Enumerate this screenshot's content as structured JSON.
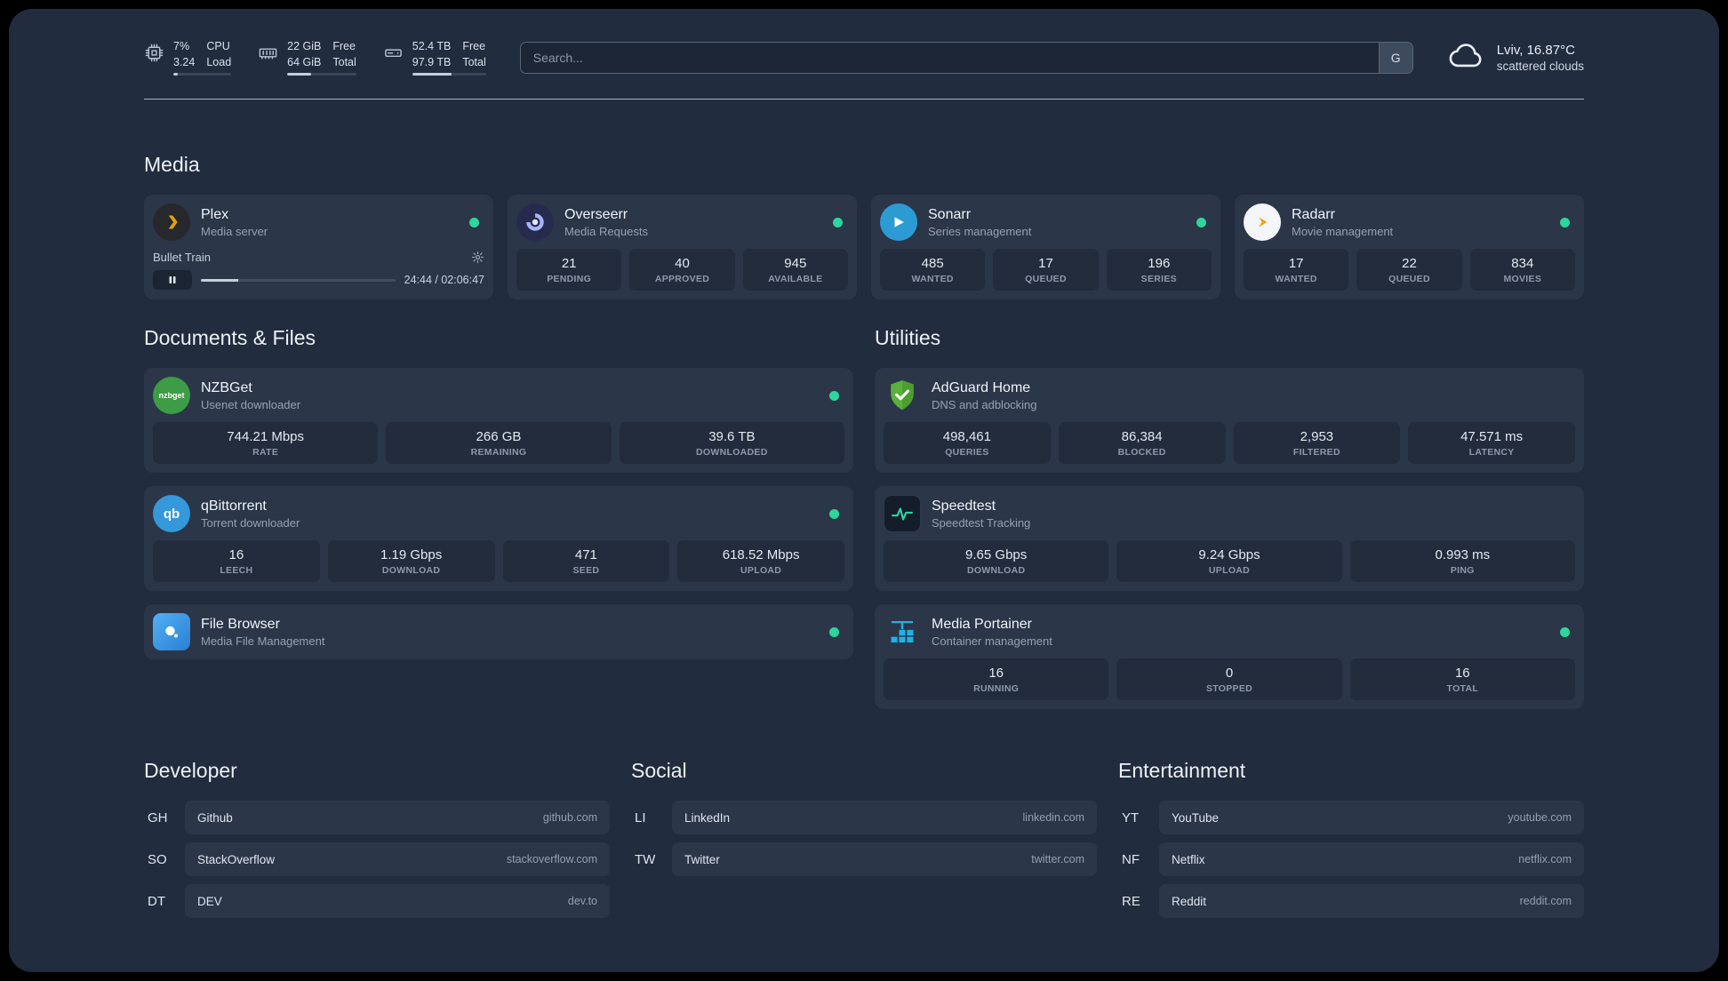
{
  "topbar": {
    "cpu": {
      "value_top": "7%",
      "value_bottom": "3.24",
      "label_top": "CPU",
      "label_bottom": "Load",
      "bar_percent": 7
    },
    "memory": {
      "value_top": "22 GiB",
      "value_bottom": "64 GiB",
      "label_top": "Free",
      "label_bottom": "Total",
      "bar_percent": 34
    },
    "disk": {
      "value_top": "52.4 TB",
      "value_bottom": "97.9 TB",
      "label_top": "Free",
      "label_bottom": "Total",
      "bar_percent": 53
    },
    "search": {
      "placeholder": "Search...",
      "button_label": "G"
    },
    "weather": {
      "location": "Lviv, 16.87°C",
      "condition": "scattered clouds"
    }
  },
  "sections": {
    "media": "Media",
    "documents": "Documents & Files",
    "utilities": "Utilities",
    "developer": "Developer",
    "social": "Social",
    "entertainment": "Entertainment"
  },
  "apps": {
    "plex": {
      "name": "Plex",
      "subtitle": "Media server",
      "status": "online",
      "player": {
        "track": "Bullet Train",
        "time": "24:44 / 02:06:47",
        "progress_percent": 19
      }
    },
    "overseerr": {
      "name": "Overseerr",
      "subtitle": "Media Requests",
      "status": "online",
      "stats": [
        {
          "value": "21",
          "label": "PENDING"
        },
        {
          "value": "40",
          "label": "APPROVED"
        },
        {
          "value": "945",
          "label": "AVAILABLE"
        }
      ]
    },
    "sonarr": {
      "name": "Sonarr",
      "subtitle": "Series management",
      "status": "online",
      "stats": [
        {
          "value": "485",
          "label": "WANTED"
        },
        {
          "value": "17",
          "label": "QUEUED"
        },
        {
          "value": "196",
          "label": "SERIES"
        }
      ]
    },
    "radarr": {
      "name": "Radarr",
      "subtitle": "Movie management",
      "status": "online",
      "stats": [
        {
          "value": "17",
          "label": "WANTED"
        },
        {
          "value": "22",
          "label": "QUEUED"
        },
        {
          "value": "834",
          "label": "MOVIES"
        }
      ]
    },
    "nzbget": {
      "name": "NZBGet",
      "subtitle": "Usenet downloader",
      "status": "online",
      "stats": [
        {
          "value": "744.21 Mbps",
          "label": "RATE"
        },
        {
          "value": "266 GB",
          "label": "REMAINING"
        },
        {
          "value": "39.6 TB",
          "label": "DOWNLOADED"
        }
      ]
    },
    "qbittorrent": {
      "name": "qBittorrent",
      "subtitle": "Torrent downloader",
      "status": "online",
      "stats": [
        {
          "value": "16",
          "label": "LEECH"
        },
        {
          "value": "1.19 Gbps",
          "label": "DOWNLOAD"
        },
        {
          "value": "471",
          "label": "SEED"
        },
        {
          "value": "618.52 Mbps",
          "label": "UPLOAD"
        }
      ]
    },
    "filebrowser": {
      "name": "File Browser",
      "subtitle": "Media File Management",
      "status": "online"
    },
    "adguard": {
      "name": "AdGuard Home",
      "subtitle": "DNS and adblocking",
      "stats": [
        {
          "value": "498,461",
          "label": "QUERIES"
        },
        {
          "value": "86,384",
          "label": "BLOCKED"
        },
        {
          "value": "2,953",
          "label": "FILTERED"
        },
        {
          "value": "47.571 ms",
          "label": "LATENCY"
        }
      ]
    },
    "speedtest": {
      "name": "Speedtest",
      "subtitle": "Speedtest Tracking",
      "stats": [
        {
          "value": "9.65 Gbps",
          "label": "DOWNLOAD"
        },
        {
          "value": "9.24 Gbps",
          "label": "UPLOAD"
        },
        {
          "value": "0.993 ms",
          "label": "PING"
        }
      ]
    },
    "portainer": {
      "name": "Media Portainer",
      "subtitle": "Container management",
      "status": "online",
      "stats": [
        {
          "value": "16",
          "label": "RUNNING"
        },
        {
          "value": "0",
          "label": "STOPPED"
        },
        {
          "value": "16",
          "label": "TOTAL"
        }
      ]
    }
  },
  "bookmarks": {
    "developer": [
      {
        "abbr": "GH",
        "name": "Github",
        "domain": "github.com"
      },
      {
        "abbr": "SO",
        "name": "StackOverflow",
        "domain": "stackoverflow.com"
      },
      {
        "abbr": "DT",
        "name": "DEV",
        "domain": "dev.to"
      }
    ],
    "social": [
      {
        "abbr": "LI",
        "name": "LinkedIn",
        "domain": "linkedin.com"
      },
      {
        "abbr": "TW",
        "name": "Twitter",
        "domain": "twitter.com"
      }
    ],
    "entertainment": [
      {
        "abbr": "YT",
        "name": "YouTube",
        "domain": "youtube.com"
      },
      {
        "abbr": "NF",
        "name": "Netflix",
        "domain": "netflix.com"
      },
      {
        "abbr": "RE",
        "name": "Reddit",
        "domain": "reddit.com"
      }
    ]
  },
  "icons": {
    "nzbget_text": "nzbget",
    "qbittorrent_text": "qb"
  },
  "colors": {
    "status_online": "#2dd79b",
    "panel_bg": "#212c3e",
    "accent_green": "#2dd4a0"
  }
}
